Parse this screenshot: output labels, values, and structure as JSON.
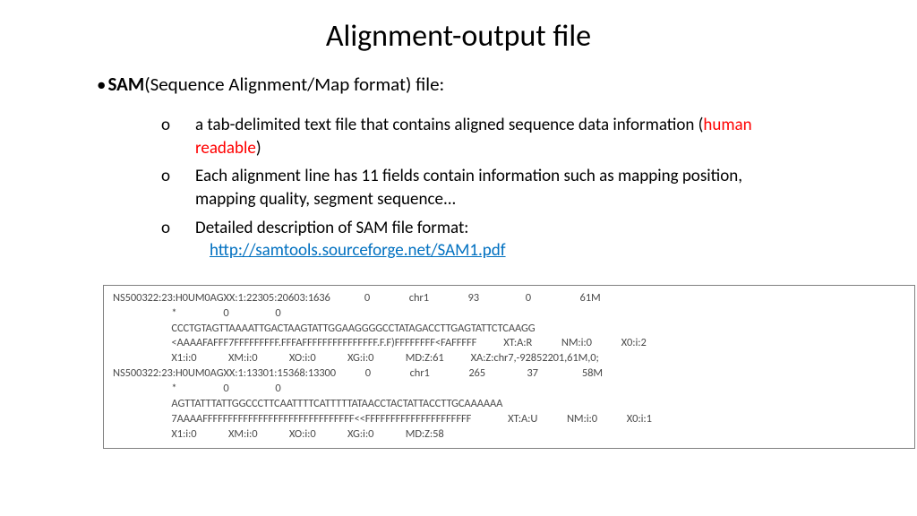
{
  "title": "Alignment-output file",
  "bullet": {
    "bold": "SAM",
    "rest": "(Sequence Alignment/Map format) file:"
  },
  "items": [
    {
      "pre": "a tab-delimited text file that contains aligned sequence data information (",
      "red": "human readable",
      "post": ")"
    },
    {
      "text": "Each alignment line has 11 fields contain information such as mapping position, mapping quality, segment sequence..."
    },
    {
      "text": "Detailed description of SAM file format:",
      "link": "http://samtools.sourceforge.net/SAM1.pdf"
    }
  ],
  "code": "NS500322:23:H0UM0AGXX:1:22305:20603:1636              0                chr1                93                   0                    61M\n                        *                   0                   0\n                        CCCTGTAGTTAAAATTGACTAAGTATTGGAAGGGGCCTATAGACCTTGAGTATTCTCAAGG\n                        <AAAAFAFFF7FFFFFFFFF.FFFAFFFFFFFFFFFFFFF.F.F)FFFFFFFF<FAFFFFF           XT:A:R            NM:i:0            X0:i:2\n                        X1:i:0             XM:i:0             XO:i:0             XG:i:0             MD:Z:61           XA:Z:chr7,-92852201,61M,0;\nNS500322:23:H0UM0AGXX:1:13301:15368:13300            0                chr1                265                 37                  58M\n                        *                   0                   0\n                        AGTTATTTATTGGCCCTTCAATTTTCATTTTTATAACCTACTATTACCTTGCAAAAAA\n                        7AAAAFFFFFFFFFFFFFFFFFFFFFFFFFFFFFF<<FFFFFFFFFFFFFFFFFFFFF               XT:A:U            NM:i:0            X0:i:1\n                        X1:i:0             XM:i:0             XO:i:0             XG:i:0             MD:Z:58"
}
